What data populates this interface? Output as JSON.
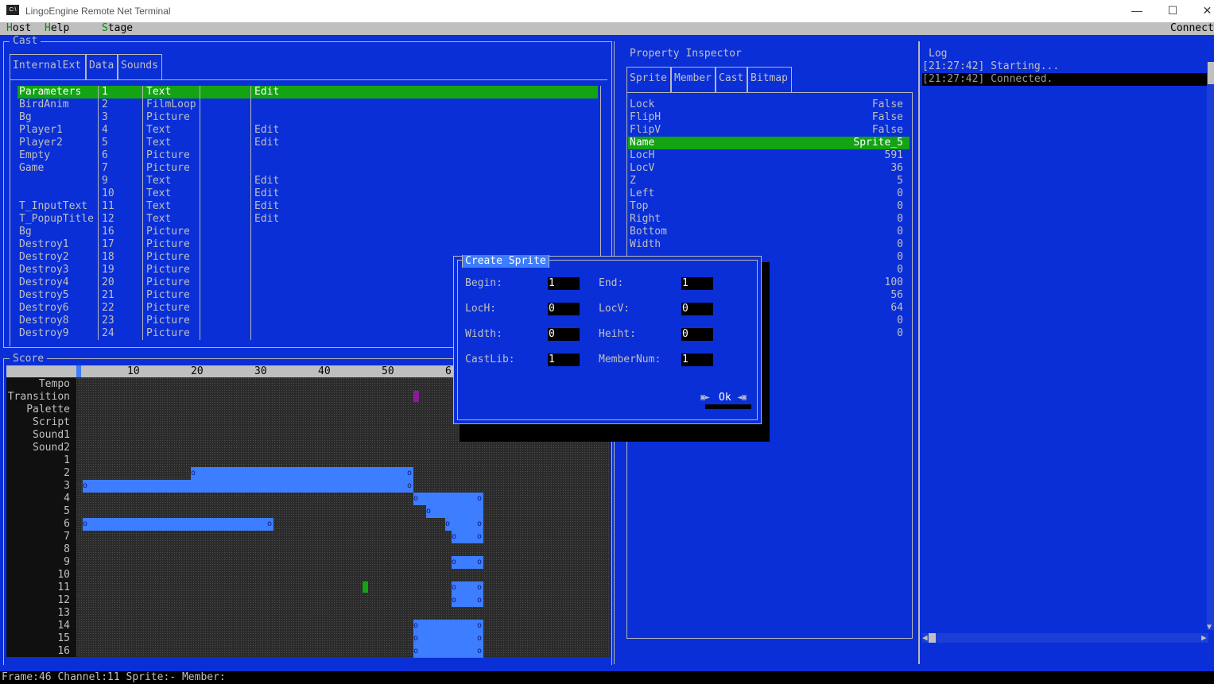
{
  "window": {
    "title": "LingoEngine Remote Net Terminal",
    "minimize": "—",
    "maximize": "☐",
    "close": "✕",
    "icon": "C:\\"
  },
  "menu": {
    "host": "Host",
    "host_hk": "H",
    "host_rest": "ost",
    "help": "Help",
    "help_hk": "H",
    "help_rest": "elp",
    "stage": "Stage",
    "stage_hk": "S",
    "stage_rest": "tage",
    "connect": "Connect"
  },
  "cast": {
    "title": "Cast",
    "tabs": [
      "InternalExt",
      "Data",
      "Sounds"
    ],
    "rows": [
      {
        "name": "Parameters",
        "num": "1",
        "type": "Text",
        "action": "Edit",
        "selected": true
      },
      {
        "name": "BirdAnim",
        "num": "2",
        "type": "FilmLoop",
        "action": ""
      },
      {
        "name": "Bg",
        "num": "3",
        "type": "Picture",
        "action": ""
      },
      {
        "name": "Player1",
        "num": "4",
        "type": "Text",
        "action": "Edit"
      },
      {
        "name": "Player2",
        "num": "5",
        "type": "Text",
        "action": "Edit"
      },
      {
        "name": "Empty",
        "num": "6",
        "type": "Picture",
        "action": ""
      },
      {
        "name": "Game",
        "num": "7",
        "type": "Picture",
        "action": ""
      },
      {
        "name": "",
        "num": "9",
        "type": "Text",
        "action": "Edit"
      },
      {
        "name": "",
        "num": "10",
        "type": "Text",
        "action": "Edit"
      },
      {
        "name": "T_InputText",
        "num": "11",
        "type": "Text",
        "action": "Edit"
      },
      {
        "name": "T_PopupTitle",
        "num": "12",
        "type": "Text",
        "action": "Edit"
      },
      {
        "name": "Bg",
        "num": "16",
        "type": "Picture",
        "action": ""
      },
      {
        "name": "Destroy1",
        "num": "17",
        "type": "Picture",
        "action": ""
      },
      {
        "name": "Destroy2",
        "num": "18",
        "type": "Picture",
        "action": ""
      },
      {
        "name": "Destroy3",
        "num": "19",
        "type": "Picture",
        "action": ""
      },
      {
        "name": "Destroy4",
        "num": "20",
        "type": "Picture",
        "action": ""
      },
      {
        "name": "Destroy5",
        "num": "21",
        "type": "Picture",
        "action": ""
      },
      {
        "name": "Destroy6",
        "num": "22",
        "type": "Picture",
        "action": ""
      },
      {
        "name": "Destroy8",
        "num": "23",
        "type": "Picture",
        "action": ""
      },
      {
        "name": "Destroy9",
        "num": "24",
        "type": "Picture",
        "action": ""
      }
    ]
  },
  "score": {
    "title": "Score",
    "ruler_ticks": [
      "10",
      "20",
      "30",
      "40",
      "50",
      "6"
    ],
    "channels": [
      "Tempo",
      "Transition",
      "Palette",
      "Script",
      "Sound1",
      "Sound2",
      "1",
      "2",
      "3",
      "4",
      "5",
      "6",
      "7",
      "8",
      "9",
      "10",
      "11",
      "12",
      "13",
      "14",
      "15",
      "16"
    ],
    "handle": "o"
  },
  "inspector": {
    "title": "Property Inspector",
    "tabs": [
      "Sprite",
      "Member",
      "Cast",
      "Bitmap"
    ],
    "props": [
      {
        "k": "Lock",
        "v": "False"
      },
      {
        "k": "FlipH",
        "v": "False"
      },
      {
        "k": "FlipV",
        "v": "False"
      },
      {
        "k": "Name",
        "v": "Sprite_5",
        "selected": true
      },
      {
        "k": "LocH",
        "v": "591"
      },
      {
        "k": "LocV",
        "v": "36"
      },
      {
        "k": "Z",
        "v": "5"
      },
      {
        "k": "Left",
        "v": "0"
      },
      {
        "k": "Top",
        "v": "0"
      },
      {
        "k": "Right",
        "v": "0"
      },
      {
        "k": "Bottom",
        "v": "0"
      },
      {
        "k": "Width",
        "v": "0"
      },
      {
        "k": "",
        "v": "0"
      },
      {
        "k": "",
        "v": "0"
      },
      {
        "k": "",
        "v": "100"
      },
      {
        "k": "",
        "v": "56"
      },
      {
        "k": "",
        "v": "64"
      },
      {
        "k": "",
        "v": "0"
      },
      {
        "k": "",
        "v": "0"
      }
    ]
  },
  "log": {
    "title": "Log",
    "lines": [
      "[21:27:42] Starting...",
      "[21:27:42] Connected."
    ]
  },
  "dialog": {
    "title": "Create Sprite",
    "begin_label": "Begin:",
    "begin": "1",
    "end_label": "End:",
    "end": "1",
    "loch_label": "LocH:",
    "loch": "0",
    "locv_label": "LocV:",
    "locv": "0",
    "width_label": "Width:",
    "width": "0",
    "height_label": "Heiht:",
    "height": "0",
    "castlib_label": "CastLib:",
    "castlib": "1",
    "membernum_label": "MemberNum:",
    "membernum": "1",
    "ok": "Ok"
  },
  "status": "Frame:46 Channel:11 Sprite:- Member:"
}
